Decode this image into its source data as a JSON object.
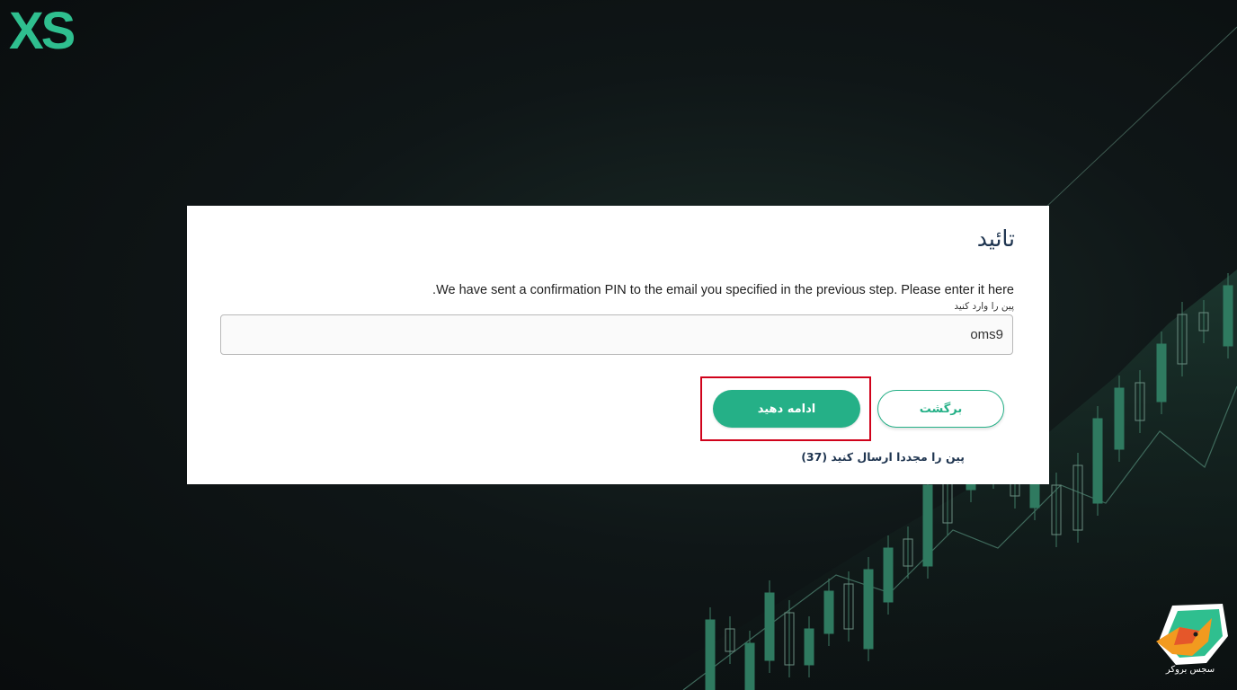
{
  "brand": {
    "logo_text": "XS",
    "accent_color": "#25b087",
    "logo_color": "#2fbf8f"
  },
  "dialog": {
    "title": "تائید",
    "message": "We have sent a confirmation PIN to the email you specified in the previous step. Please enter it here.",
    "pin_label": "پین را وارد کنید",
    "pin_value": "oms9",
    "continue_label": "ادامه دهید",
    "back_label": "برگشت",
    "resend_label": "پین را مجددا ارسال کنید (37)"
  },
  "watermark": {
    "text": "سجس بروکر"
  },
  "icons": [
    "xs-logo-icon",
    "watermark-fox-icon"
  ]
}
